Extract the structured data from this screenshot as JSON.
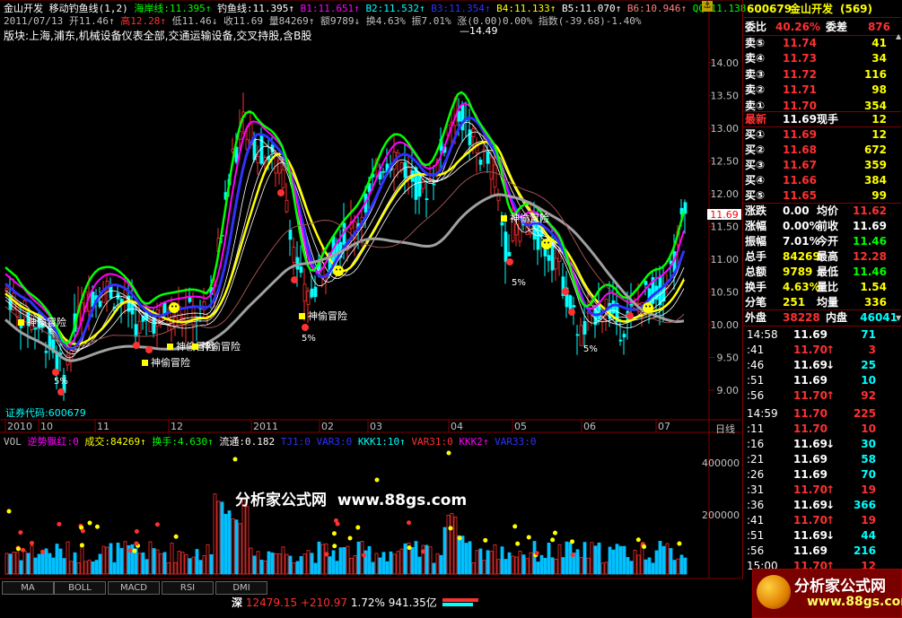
{
  "header": {
    "line1": [
      {
        "t": "金山开发  移动钓鱼线(1,2)",
        "c": "#ffffff"
      },
      {
        "t": "海岸线:11.395↑",
        "c": "#00ff00"
      },
      {
        "t": "钓鱼线:11.395↑",
        "c": "#ffffff"
      },
      {
        "t": "B1:11.651↑",
        "c": "#ff00ff"
      },
      {
        "t": "B2:11.532↑",
        "c": "#00ffff"
      },
      {
        "t": "B3:11.354↑",
        "c": "#3030ff"
      },
      {
        "t": "B4:11.133↑",
        "c": "#ffff00"
      },
      {
        "t": "B5:11.070↑",
        "c": "#ffffff"
      },
      {
        "t": "B6:10.946↑",
        "c": "#ff8080"
      },
      {
        "t": "QQ:11.138↑",
        "c": "#00ff00"
      }
    ],
    "line2": [
      {
        "t": "2011/07/13 开11.46↑",
        "c": "#c0c0c0"
      },
      {
        "t": "高12.28↑",
        "c": "#ff3030"
      },
      {
        "t": "低11.46↓",
        "c": "#c0c0c0"
      },
      {
        "t": "收11.69",
        "c": "#c0c0c0"
      },
      {
        "t": "量84269↑",
        "c": "#c0c0c0"
      },
      {
        "t": "额9789↓",
        "c": "#c0c0c0"
      },
      {
        "t": "换4.63%",
        "c": "#c0c0c0"
      },
      {
        "t": "振7.01%",
        "c": "#c0c0c0"
      },
      {
        "t": "涨(0.00)0.00%",
        "c": "#c0c0c0"
      },
      {
        "t": "指数(-39.68)-1.40%",
        "c": "#c0c0c0"
      }
    ],
    "sector": "版块:上海,浦东,机械设备仪表全部,交通运输设备,交叉持股,含B股"
  },
  "chart_labels": {
    "stock_code": "证券代码:600679",
    "high_label": "14.49",
    "current_tag": "11.69",
    "daily": "日线",
    "watermark": "分析家公式网  www.88gs.com",
    "signal": "神偷冒险",
    "pct": "5%"
  },
  "price_axis": [
    "14.00",
    "13.50",
    "13.00",
    "12.50",
    "12.00",
    "11.50",
    "11.00",
    "10.50",
    "10.00",
    "9.50",
    "9.00"
  ],
  "time_axis": [
    "2010",
    "10",
    "11",
    "12",
    "2011",
    "02",
    "03",
    "04",
    "05",
    "06",
    "07"
  ],
  "vol_header": [
    {
      "t": "VOL",
      "c": "#c0c0c0"
    },
    {
      "t": "逆势飘红:0",
      "c": "#ff00ff"
    },
    {
      "t": "成交:84269↑",
      "c": "#ffff00"
    },
    {
      "t": "换手:4.630↑",
      "c": "#00ff00"
    },
    {
      "t": "流通:0.182",
      "c": "#ffffff"
    },
    {
      "t": "TJ1:0",
      "c": "#3030ff"
    },
    {
      "t": "VAR3:0",
      "c": "#3030ff"
    },
    {
      "t": "KKK1:10↑",
      "c": "#00ffff"
    },
    {
      "t": "VAR31:0",
      "c": "#ff3030"
    },
    {
      "t": "KKK2↑",
      "c": "#ff00ff"
    },
    {
      "t": "VAR33:0",
      "c": "#3030ff"
    }
  ],
  "vol_axis": [
    "400000",
    "200000"
  ],
  "tabs": [
    "MA",
    "BOLL",
    "MACD",
    "RSI",
    "DMI"
  ],
  "index_bar": {
    "name": "深",
    "value": "12479.15",
    "change": "+210.97",
    "pct": "1.72%",
    "amount": "941.35亿"
  },
  "quote": {
    "code": "600679",
    "name": "金山开发",
    "num": "(569)",
    "weibi_label": "委比",
    "weibi": "40.26%",
    "weicha_label": "委差",
    "weicha": "876",
    "sells": [
      {
        "l": "卖⑤",
        "p": "11.74",
        "v": "41"
      },
      {
        "l": "卖④",
        "p": "11.73",
        "v": "34"
      },
      {
        "l": "卖③",
        "p": "11.72",
        "v": "116"
      },
      {
        "l": "卖②",
        "p": "11.71",
        "v": "98"
      },
      {
        "l": "卖①",
        "p": "11.70",
        "v": "354"
      }
    ],
    "latest_label": "最新",
    "latest": "11.69",
    "xianshou_label": "现手",
    "xianshou": "12",
    "buys": [
      {
        "l": "买①",
        "p": "11.69",
        "v": "12"
      },
      {
        "l": "买②",
        "p": "11.68",
        "v": "672"
      },
      {
        "l": "买③",
        "p": "11.67",
        "v": "359"
      },
      {
        "l": "买④",
        "p": "11.66",
        "v": "384"
      },
      {
        "l": "买⑤",
        "p": "11.65",
        "v": "99"
      }
    ],
    "stats": [
      {
        "l1": "涨跌",
        "v1": "0.00",
        "c1": "#ffffff",
        "l2": "均价",
        "v2": "11.62",
        "c2": "#ff3030"
      },
      {
        "l1": "涨幅",
        "v1": "0.00%",
        "c1": "#ffffff",
        "l2": "前收",
        "v2": "11.69",
        "c2": "#ffffff"
      },
      {
        "l1": "振幅",
        "v1": "7.01%",
        "c1": "#ffffff",
        "l2": "今开",
        "v2": "11.46",
        "c2": "#00ff00"
      },
      {
        "l1": "总手",
        "v1": "84269",
        "c1": "#ffff00",
        "l2": "最高",
        "v2": "12.28",
        "c2": "#ff3030"
      },
      {
        "l1": "总额",
        "v1": "9789",
        "c1": "#ffff00",
        "l2": "最低",
        "v2": "11.46",
        "c2": "#00ff00"
      },
      {
        "l1": "换手",
        "v1": "4.63%",
        "c1": "#ffff00",
        "l2": "量比",
        "v2": "1.54",
        "c2": "#ffff00"
      },
      {
        "l1": "分笔",
        "v1": "251",
        "c1": "#ffff00",
        "l2": "均量",
        "v2": "336",
        "c2": "#ffff00"
      }
    ],
    "outer_label": "外盘",
    "outer": "38228",
    "inner_label": "内盘",
    "inner": "46041",
    "ticks": [
      {
        "t": "14:58",
        "p": "11.69",
        "a": "",
        "pc": "#ffffff",
        "v": "71",
        "vc": "#00ffff"
      },
      {
        "t": ":41",
        "p": "11.70",
        "a": "↑",
        "pc": "#ff3030",
        "v": "3",
        "vc": "#ff3030"
      },
      {
        "t": ":46",
        "p": "11.69",
        "a": "↓",
        "pc": "#ffffff",
        "v": "25",
        "vc": "#00ffff"
      },
      {
        "t": ":51",
        "p": "11.69",
        "a": "",
        "pc": "#ffffff",
        "v": "10",
        "vc": "#00ffff"
      },
      {
        "t": ":56",
        "p": "11.70",
        "a": "↑",
        "pc": "#ff3030",
        "v": "92",
        "vc": "#ff3030"
      },
      {
        "t": "14:59",
        "p": "11.70",
        "a": "",
        "pc": "#ff3030",
        "v": "225",
        "vc": "#ff3030"
      },
      {
        "t": ":11",
        "p": "11.70",
        "a": "",
        "pc": "#ff3030",
        "v": "10",
        "vc": "#ff3030"
      },
      {
        "t": ":16",
        "p": "11.69",
        "a": "↓",
        "pc": "#ffffff",
        "v": "30",
        "vc": "#00ffff"
      },
      {
        "t": ":21",
        "p": "11.69",
        "a": "",
        "pc": "#ffffff",
        "v": "58",
        "vc": "#00ffff"
      },
      {
        "t": ":26",
        "p": "11.69",
        "a": "",
        "pc": "#ffffff",
        "v": "70",
        "vc": "#00ffff"
      },
      {
        "t": ":31",
        "p": "11.70",
        "a": "↑",
        "pc": "#ff3030",
        "v": "19",
        "vc": "#ff3030"
      },
      {
        "t": ":36",
        "p": "11.69",
        "a": "↓",
        "pc": "#ffffff",
        "v": "366",
        "vc": "#00ffff"
      },
      {
        "t": ":41",
        "p": "11.70",
        "a": "↑",
        "pc": "#ff3030",
        "v": "19",
        "vc": "#ff3030"
      },
      {
        "t": ":51",
        "p": "11.69",
        "a": "↓",
        "pc": "#ffffff",
        "v": "44",
        "vc": "#00ffff"
      },
      {
        "t": ":56",
        "p": "11.69",
        "a": "",
        "pc": "#ffffff",
        "v": "216",
        "vc": "#00ffff"
      },
      {
        "t": "15:00",
        "p": "11.70",
        "a": "↑",
        "pc": "#ff3030",
        "v": "12",
        "vc": "#ff3030"
      }
    ]
  },
  "logo": {
    "cn": "分析家公式网",
    "url": "www.88gs.com"
  },
  "colors": {
    "up": "#ff3030",
    "down": "#00ffff",
    "frame": "#800000"
  }
}
